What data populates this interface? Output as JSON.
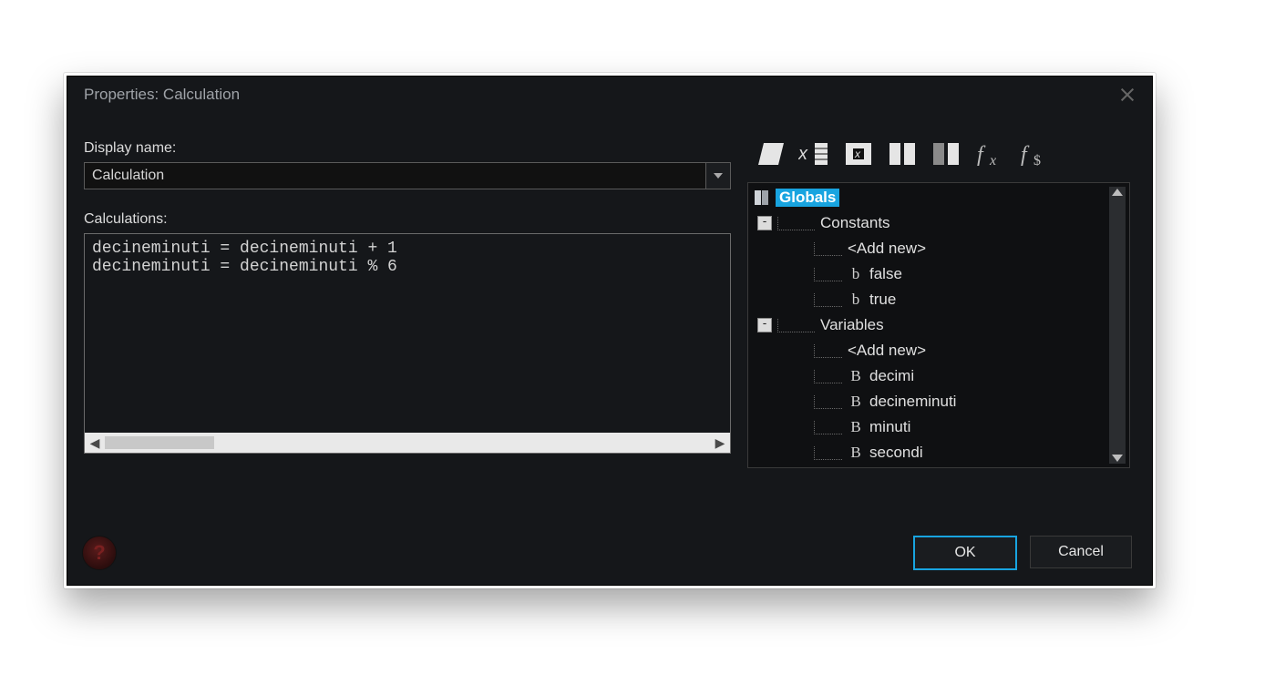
{
  "title": "Properties: Calculation",
  "labels": {
    "displayName": "Display name:",
    "calculations": "Calculations:"
  },
  "displayName": "Calculation",
  "code": "decineminuti = decineminuti + 1\ndecineminuti = decineminuti % 6",
  "tree": {
    "root": "Globals",
    "group1": "Constants",
    "group1_items": {
      "addNew": "<Add new>",
      "false": "false",
      "true": "true"
    },
    "group2": "Variables",
    "group2_items": {
      "addNew": "<Add new>",
      "v1": "decimi",
      "v2": "decineminuti",
      "v3": "minuti",
      "v4": "secondi"
    }
  },
  "buttons": {
    "ok": "OK",
    "cancel": "Cancel"
  }
}
